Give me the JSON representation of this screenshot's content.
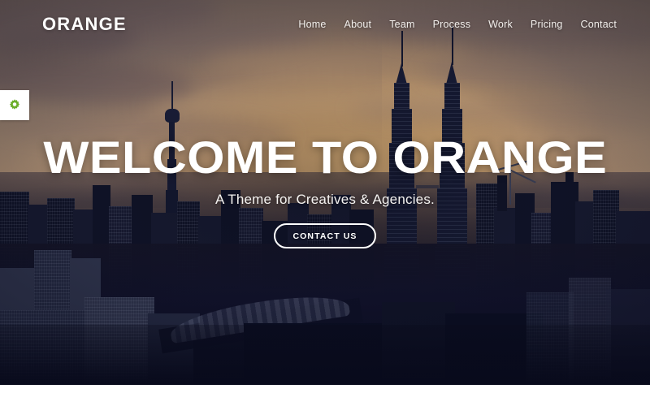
{
  "site": {
    "logo_text": "ORANGE"
  },
  "nav": {
    "items": [
      {
        "label": "Home",
        "name": "home"
      },
      {
        "label": "About",
        "name": "about"
      },
      {
        "label": "Team",
        "name": "team"
      },
      {
        "label": "Process",
        "name": "process"
      },
      {
        "label": "Work",
        "name": "work"
      },
      {
        "label": "Pricing",
        "name": "pricing"
      },
      {
        "label": "Contact",
        "name": "contact"
      }
    ]
  },
  "settings_badge": {
    "icon": "gear-icon",
    "icon_color": "#6cad2a",
    "background": "#ffffff"
  },
  "hero": {
    "title": "WELCOME TO ORANGE",
    "subtitle": "A Theme for Creatives & Agencies.",
    "cta_label": "CONTACT US",
    "background_subject": "Kuala Lumpur skyline at sunset with Petronas Twin Towers and KL Tower"
  },
  "colors": {
    "text_light": "#ffffff",
    "accent_green": "#6cad2a",
    "sky_warm": "#c6a27e",
    "sky_mauve": "#8a7466",
    "city_dark": "#0b0c20",
    "bottom_strip": "#ffffff"
  }
}
